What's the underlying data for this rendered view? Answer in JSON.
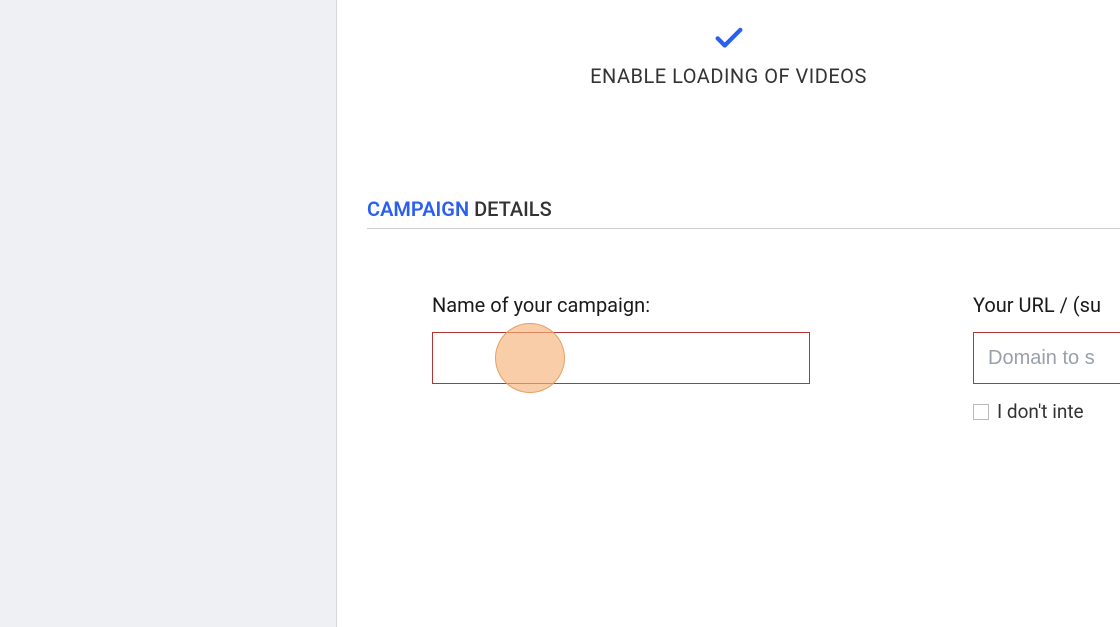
{
  "header": {
    "enable_videos_label": "ENABLE LOADING OF VIDEOS"
  },
  "section": {
    "title_highlight": "CAMPAIGN",
    "title_rest": " DETAILS"
  },
  "form": {
    "name": {
      "label": "Name of your campaign:",
      "value": ""
    },
    "url": {
      "label": "Your URL / (su",
      "placeholder": "Domain to s",
      "value": ""
    },
    "no_intent_checkbox": {
      "label": "I don't inte",
      "checked": false
    }
  },
  "colors": {
    "accent": "#2b5fef",
    "error_border": "#b53434",
    "sidebar_bg": "#eff0f4"
  }
}
